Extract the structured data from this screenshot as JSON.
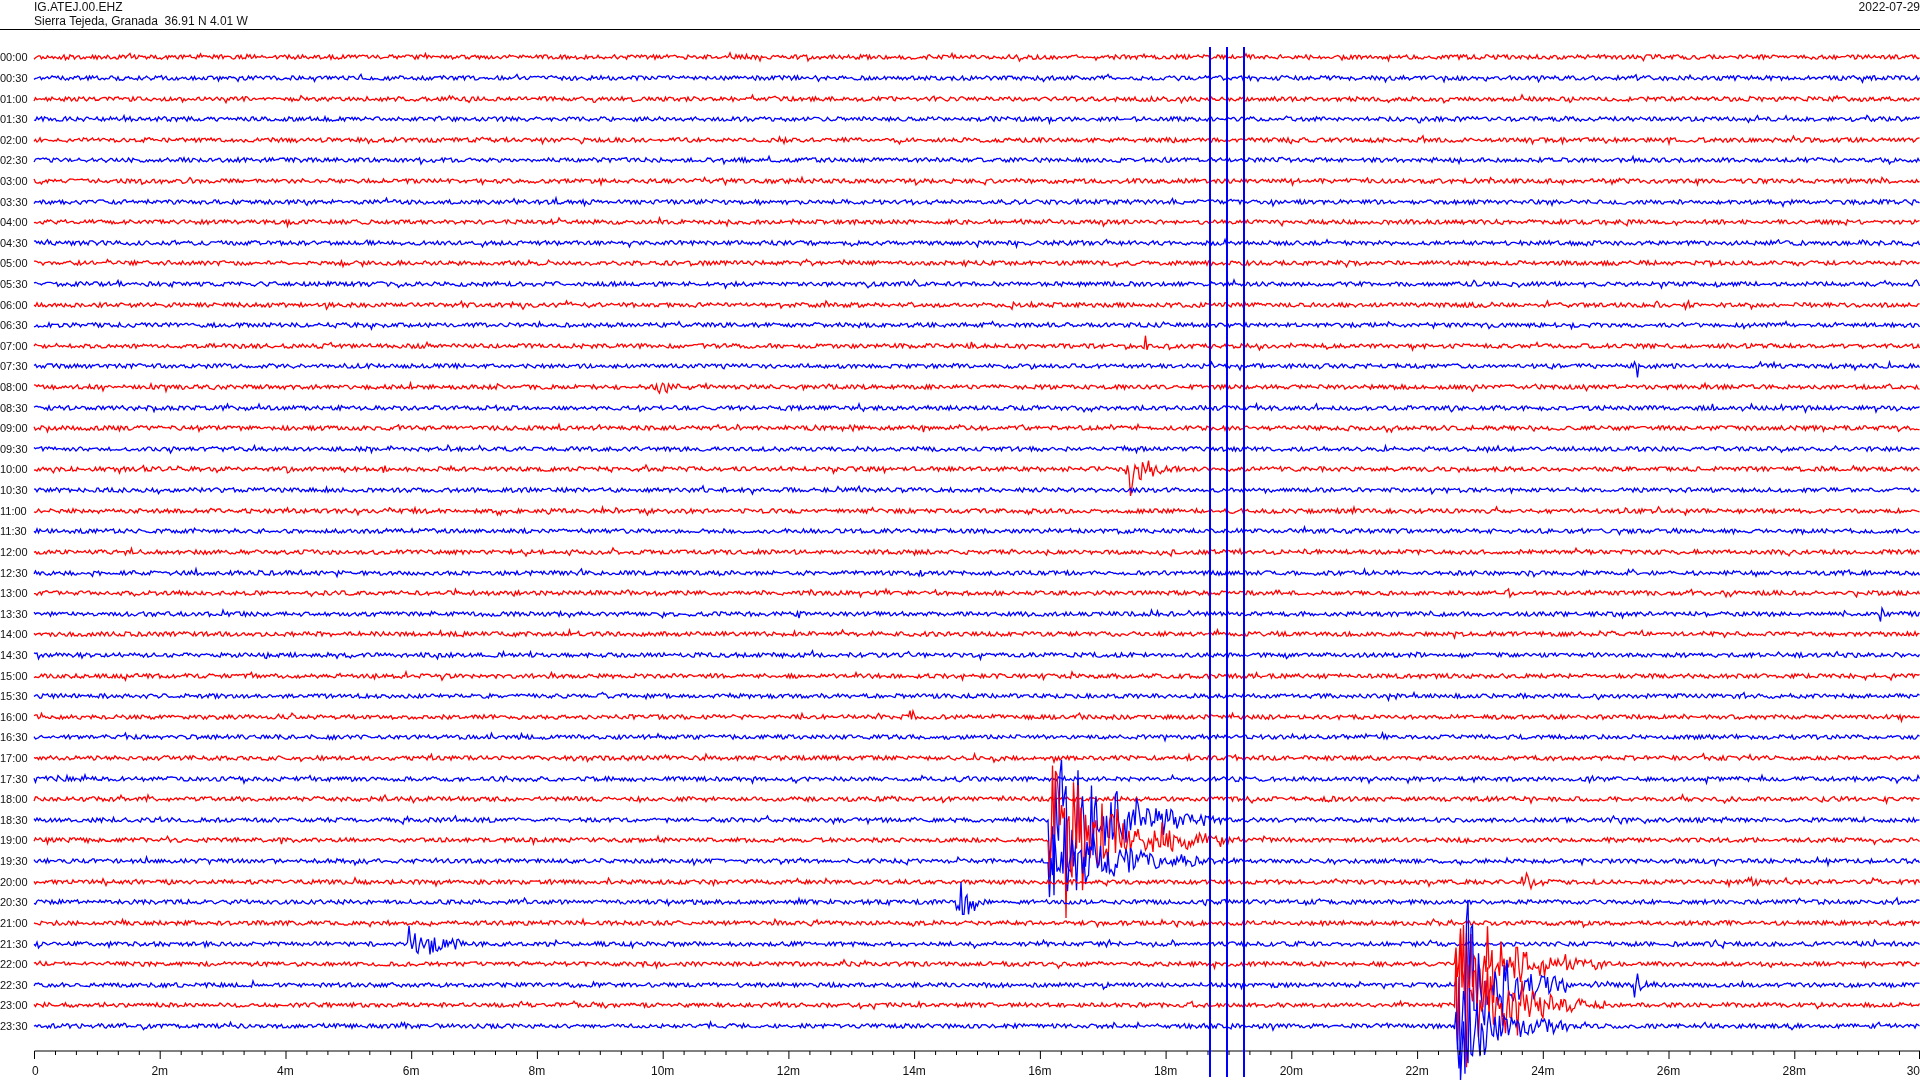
{
  "header": {
    "station": "IG.ATEJ.00.EHZ",
    "location": "Sierra Tejeda, Granada  36.91 N 4.01 W",
    "date": "2022-07-29"
  },
  "rows": [
    {
      "label": "00:00",
      "color": "#ff0000"
    },
    {
      "label": "00:30",
      "color": "#0000ff"
    },
    {
      "label": "01:00",
      "color": "#ff0000"
    },
    {
      "label": "01:30",
      "color": "#0000ff"
    },
    {
      "label": "02:00",
      "color": "#ff0000"
    },
    {
      "label": "02:30",
      "color": "#0000ff"
    },
    {
      "label": "03:00",
      "color": "#ff0000"
    },
    {
      "label": "03:30",
      "color": "#0000ff"
    },
    {
      "label": "04:00",
      "color": "#ff0000"
    },
    {
      "label": "04:30",
      "color": "#0000ff"
    },
    {
      "label": "05:00",
      "color": "#ff0000"
    },
    {
      "label": "05:30",
      "color": "#0000ff"
    },
    {
      "label": "06:00",
      "color": "#ff0000"
    },
    {
      "label": "06:30",
      "color": "#0000ff"
    },
    {
      "label": "07:00",
      "color": "#ff0000"
    },
    {
      "label": "07:30",
      "color": "#0000ff"
    },
    {
      "label": "08:00",
      "color": "#ff0000"
    },
    {
      "label": "08:30",
      "color": "#0000ff"
    },
    {
      "label": "09:00",
      "color": "#ff0000"
    },
    {
      "label": "09:30",
      "color": "#0000ff"
    },
    {
      "label": "10:00",
      "color": "#ff0000"
    },
    {
      "label": "10:30",
      "color": "#0000ff"
    },
    {
      "label": "11:00",
      "color": "#ff0000"
    },
    {
      "label": "11:30",
      "color": "#0000ff"
    },
    {
      "label": "12:00",
      "color": "#ff0000"
    },
    {
      "label": "12:30",
      "color": "#0000ff"
    },
    {
      "label": "13:00",
      "color": "#ff0000"
    },
    {
      "label": "13:30",
      "color": "#0000ff"
    },
    {
      "label": "14:00",
      "color": "#ff0000"
    },
    {
      "label": "14:30",
      "color": "#0000ff"
    },
    {
      "label": "15:00",
      "color": "#ff0000"
    },
    {
      "label": "15:30",
      "color": "#0000ff"
    },
    {
      "label": "16:00",
      "color": "#ff0000"
    },
    {
      "label": "16:30",
      "color": "#0000ff"
    },
    {
      "label": "17:00",
      "color": "#ff0000"
    },
    {
      "label": "17:30",
      "color": "#0000ff"
    },
    {
      "label": "18:00",
      "color": "#ff0000"
    },
    {
      "label": "18:30",
      "color": "#0000ff"
    },
    {
      "label": "19:00",
      "color": "#ff0000"
    },
    {
      "label": "19:30",
      "color": "#0000ff"
    },
    {
      "label": "20:00",
      "color": "#ff0000"
    },
    {
      "label": "20:30",
      "color": "#0000ff"
    },
    {
      "label": "21:00",
      "color": "#ff0000"
    },
    {
      "label": "21:30",
      "color": "#0000ff"
    },
    {
      "label": "22:00",
      "color": "#ff0000"
    },
    {
      "label": "22:30",
      "color": "#0000ff"
    },
    {
      "label": "23:00",
      "color": "#ff0000"
    },
    {
      "label": "23:30",
      "color": "#0000ff"
    }
  ],
  "x_axis": {
    "ticks": [
      "0",
      "2m",
      "4m",
      "6m",
      "8m",
      "10m",
      "12m",
      "14m",
      "16m",
      "18m",
      "20m",
      "22m",
      "24m",
      "26m",
      "28m",
      "30"
    ]
  }
}
